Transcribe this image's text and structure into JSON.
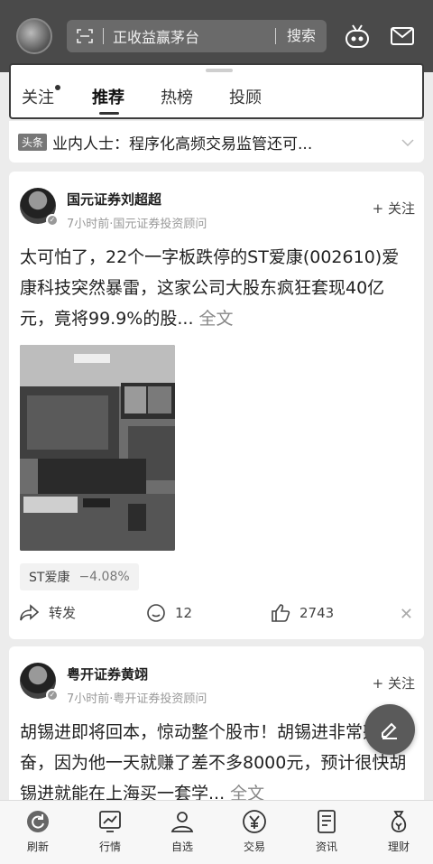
{
  "header": {
    "search_placeholder": "正收益赢茅台",
    "search_button": "搜索"
  },
  "tabs": [
    {
      "label": "关注"
    },
    {
      "label": "推荐"
    },
    {
      "label": "热榜"
    },
    {
      "label": "投顾"
    }
  ],
  "headline": {
    "tag": "头条",
    "text": "业内人士：程序化高频交易监管还可..."
  },
  "posts": [
    {
      "author": "国元证券刘超超",
      "subtitle": "7小时前·国元证券投资顾问",
      "follow": "+ 关注",
      "body": "太可怕了，22个一字板跌停的ST爱康(002610)爱康科技突然暴雷，这家公司大股东疯狂套现40亿元，竟将99.9%的股...",
      "more": "全文",
      "stock_name": "ST爱康",
      "stock_change": "−4.08%",
      "repost": "转发",
      "comments": "12",
      "likes": "2743"
    },
    {
      "author": "粤开证券黄翊",
      "subtitle": "7小时前·粤开证券投资顾问",
      "follow": "+ 关注",
      "body": "胡锡进即将回本，惊动整个股市！胡锡进非常兴奋，因为他一天就赚了差不多8000元，预计很快胡锡进就能在上海买一套学...",
      "more": "全文"
    }
  ],
  "bottom_nav": [
    {
      "label": "刷新",
      "icon": "refresh-icon"
    },
    {
      "label": "行情",
      "icon": "chart-icon"
    },
    {
      "label": "自选",
      "icon": "user-icon"
    },
    {
      "label": "交易",
      "icon": "yen-icon"
    },
    {
      "label": "资讯",
      "icon": "document-icon"
    },
    {
      "label": "理财",
      "icon": "money-bag-icon"
    }
  ]
}
